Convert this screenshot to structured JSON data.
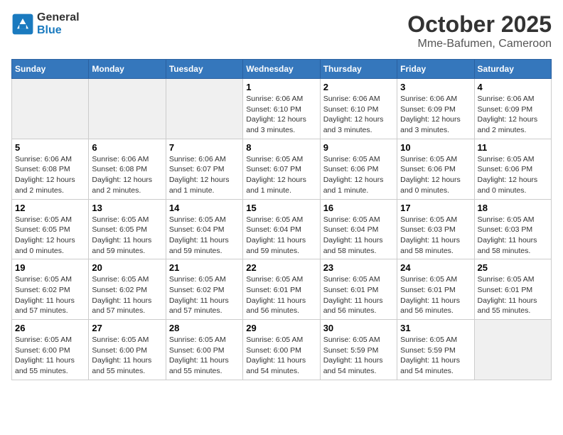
{
  "header": {
    "logo_line1": "General",
    "logo_line2": "Blue",
    "month": "October 2025",
    "location": "Mme-Bafumen, Cameroon"
  },
  "weekdays": [
    "Sunday",
    "Monday",
    "Tuesday",
    "Wednesday",
    "Thursday",
    "Friday",
    "Saturday"
  ],
  "weeks": [
    [
      {
        "day": "",
        "info": ""
      },
      {
        "day": "",
        "info": ""
      },
      {
        "day": "",
        "info": ""
      },
      {
        "day": "1",
        "info": "Sunrise: 6:06 AM\nSunset: 6:10 PM\nDaylight: 12 hours\nand 3 minutes."
      },
      {
        "day": "2",
        "info": "Sunrise: 6:06 AM\nSunset: 6:10 PM\nDaylight: 12 hours\nand 3 minutes."
      },
      {
        "day": "3",
        "info": "Sunrise: 6:06 AM\nSunset: 6:09 PM\nDaylight: 12 hours\nand 3 minutes."
      },
      {
        "day": "4",
        "info": "Sunrise: 6:06 AM\nSunset: 6:09 PM\nDaylight: 12 hours\nand 2 minutes."
      }
    ],
    [
      {
        "day": "5",
        "info": "Sunrise: 6:06 AM\nSunset: 6:08 PM\nDaylight: 12 hours\nand 2 minutes."
      },
      {
        "day": "6",
        "info": "Sunrise: 6:06 AM\nSunset: 6:08 PM\nDaylight: 12 hours\nand 2 minutes."
      },
      {
        "day": "7",
        "info": "Sunrise: 6:06 AM\nSunset: 6:07 PM\nDaylight: 12 hours\nand 1 minute."
      },
      {
        "day": "8",
        "info": "Sunrise: 6:05 AM\nSunset: 6:07 PM\nDaylight: 12 hours\nand 1 minute."
      },
      {
        "day": "9",
        "info": "Sunrise: 6:05 AM\nSunset: 6:06 PM\nDaylight: 12 hours\nand 1 minute."
      },
      {
        "day": "10",
        "info": "Sunrise: 6:05 AM\nSunset: 6:06 PM\nDaylight: 12 hours\nand 0 minutes."
      },
      {
        "day": "11",
        "info": "Sunrise: 6:05 AM\nSunset: 6:06 PM\nDaylight: 12 hours\nand 0 minutes."
      }
    ],
    [
      {
        "day": "12",
        "info": "Sunrise: 6:05 AM\nSunset: 6:05 PM\nDaylight: 12 hours\nand 0 minutes."
      },
      {
        "day": "13",
        "info": "Sunrise: 6:05 AM\nSunset: 6:05 PM\nDaylight: 11 hours\nand 59 minutes."
      },
      {
        "day": "14",
        "info": "Sunrise: 6:05 AM\nSunset: 6:04 PM\nDaylight: 11 hours\nand 59 minutes."
      },
      {
        "day": "15",
        "info": "Sunrise: 6:05 AM\nSunset: 6:04 PM\nDaylight: 11 hours\nand 59 minutes."
      },
      {
        "day": "16",
        "info": "Sunrise: 6:05 AM\nSunset: 6:04 PM\nDaylight: 11 hours\nand 58 minutes."
      },
      {
        "day": "17",
        "info": "Sunrise: 6:05 AM\nSunset: 6:03 PM\nDaylight: 11 hours\nand 58 minutes."
      },
      {
        "day": "18",
        "info": "Sunrise: 6:05 AM\nSunset: 6:03 PM\nDaylight: 11 hours\nand 58 minutes."
      }
    ],
    [
      {
        "day": "19",
        "info": "Sunrise: 6:05 AM\nSunset: 6:02 PM\nDaylight: 11 hours\nand 57 minutes."
      },
      {
        "day": "20",
        "info": "Sunrise: 6:05 AM\nSunset: 6:02 PM\nDaylight: 11 hours\nand 57 minutes."
      },
      {
        "day": "21",
        "info": "Sunrise: 6:05 AM\nSunset: 6:02 PM\nDaylight: 11 hours\nand 57 minutes."
      },
      {
        "day": "22",
        "info": "Sunrise: 6:05 AM\nSunset: 6:01 PM\nDaylight: 11 hours\nand 56 minutes."
      },
      {
        "day": "23",
        "info": "Sunrise: 6:05 AM\nSunset: 6:01 PM\nDaylight: 11 hours\nand 56 minutes."
      },
      {
        "day": "24",
        "info": "Sunrise: 6:05 AM\nSunset: 6:01 PM\nDaylight: 11 hours\nand 56 minutes."
      },
      {
        "day": "25",
        "info": "Sunrise: 6:05 AM\nSunset: 6:01 PM\nDaylight: 11 hours\nand 55 minutes."
      }
    ],
    [
      {
        "day": "26",
        "info": "Sunrise: 6:05 AM\nSunset: 6:00 PM\nDaylight: 11 hours\nand 55 minutes."
      },
      {
        "day": "27",
        "info": "Sunrise: 6:05 AM\nSunset: 6:00 PM\nDaylight: 11 hours\nand 55 minutes."
      },
      {
        "day": "28",
        "info": "Sunrise: 6:05 AM\nSunset: 6:00 PM\nDaylight: 11 hours\nand 55 minutes."
      },
      {
        "day": "29",
        "info": "Sunrise: 6:05 AM\nSunset: 6:00 PM\nDaylight: 11 hours\nand 54 minutes."
      },
      {
        "day": "30",
        "info": "Sunrise: 6:05 AM\nSunset: 5:59 PM\nDaylight: 11 hours\nand 54 minutes."
      },
      {
        "day": "31",
        "info": "Sunrise: 6:05 AM\nSunset: 5:59 PM\nDaylight: 11 hours\nand 54 minutes."
      },
      {
        "day": "",
        "info": ""
      }
    ]
  ]
}
